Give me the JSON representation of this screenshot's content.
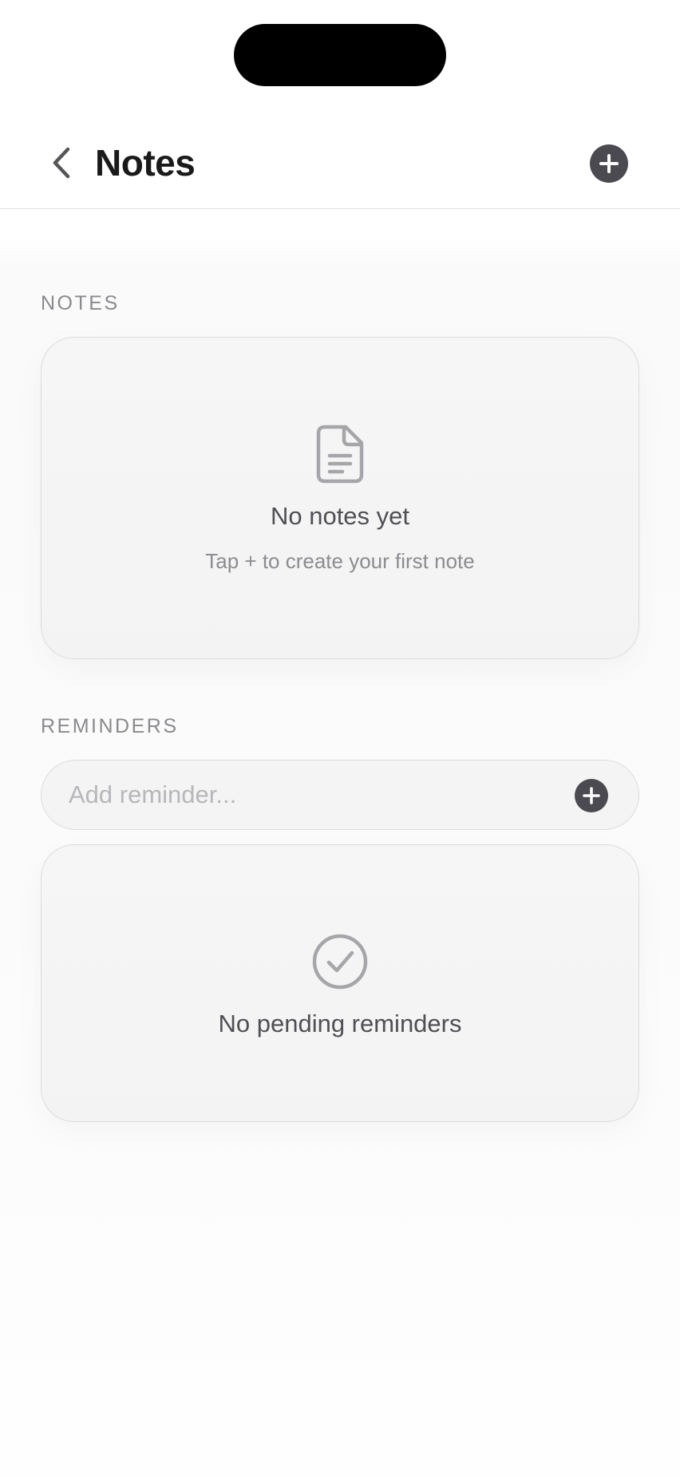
{
  "header": {
    "title": "Notes",
    "back_icon": "chevron-left-icon",
    "add_icon": "plus-circle-icon"
  },
  "notes_section": {
    "label": "NOTES",
    "empty_icon": "document-icon",
    "empty_title": "No notes yet",
    "empty_subtitle": "Tap + to create your first note"
  },
  "reminders_section": {
    "label": "REMINDERS",
    "input_placeholder": "Add reminder...",
    "input_value": "",
    "add_icon": "plus-circle-icon",
    "empty_icon": "checkmark-circle-icon",
    "empty_title": "No pending reminders"
  },
  "colors": {
    "accent_button": "#4a4a50",
    "card_background": "#f4f4f4",
    "muted_text": "#8a8a8e"
  }
}
